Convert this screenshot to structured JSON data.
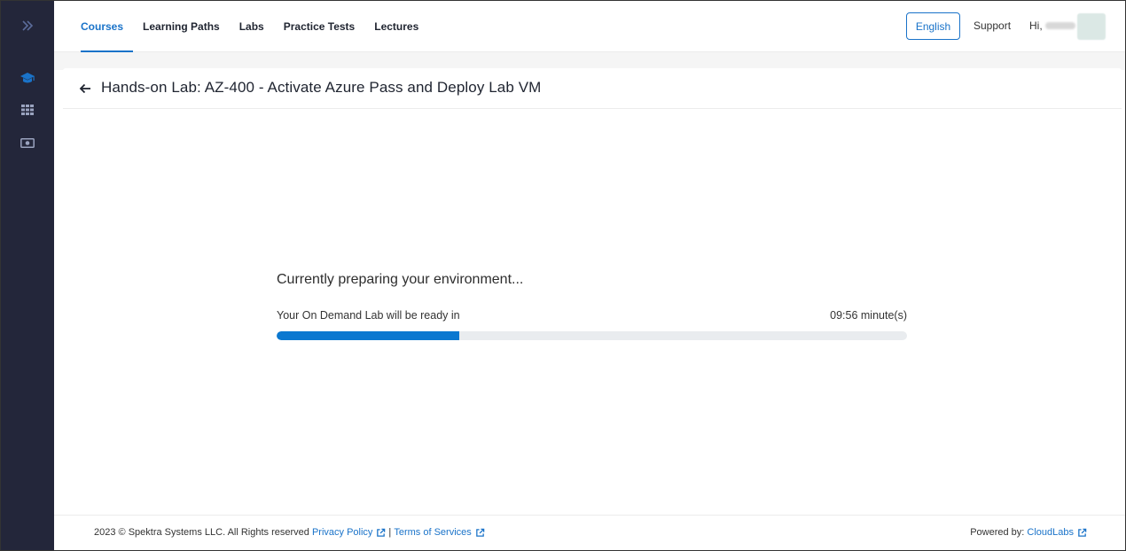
{
  "sidebar": {
    "items": [
      {
        "icon": "chevrons-right-icon"
      },
      {
        "icon": "graduation-cap-icon"
      },
      {
        "icon": "grid-icon"
      },
      {
        "icon": "money-icon"
      }
    ]
  },
  "nav": {
    "items": [
      "Courses",
      "Learning Paths",
      "Labs",
      "Practice Tests",
      "Lectures"
    ],
    "active": "Courses"
  },
  "header": {
    "language": "English",
    "support": "Support",
    "greeting": "Hi,"
  },
  "page": {
    "title": "Hands-on Lab: AZ-400 - Activate Azure Pass and Deploy Lab VM"
  },
  "status": {
    "message": "Currently preparing your environment...",
    "ready_label": "Your On Demand Lab will be ready in",
    "ready_time": "09:56 minute(s)",
    "progress_fraction": 0.29
  },
  "footer": {
    "copyright": "2023 © Spektra Systems LLC. All Rights reserved",
    "privacy": "Privacy Policy",
    "separator": "|",
    "terms": "Terms of Services",
    "powered_label": "Powered by:",
    "powered_link": "CloudLabs"
  },
  "colors": {
    "sidebar_bg": "#23263a",
    "accent": "#1a73c9",
    "progress": "#0b78d0",
    "progress_track": "#e9ecef"
  }
}
